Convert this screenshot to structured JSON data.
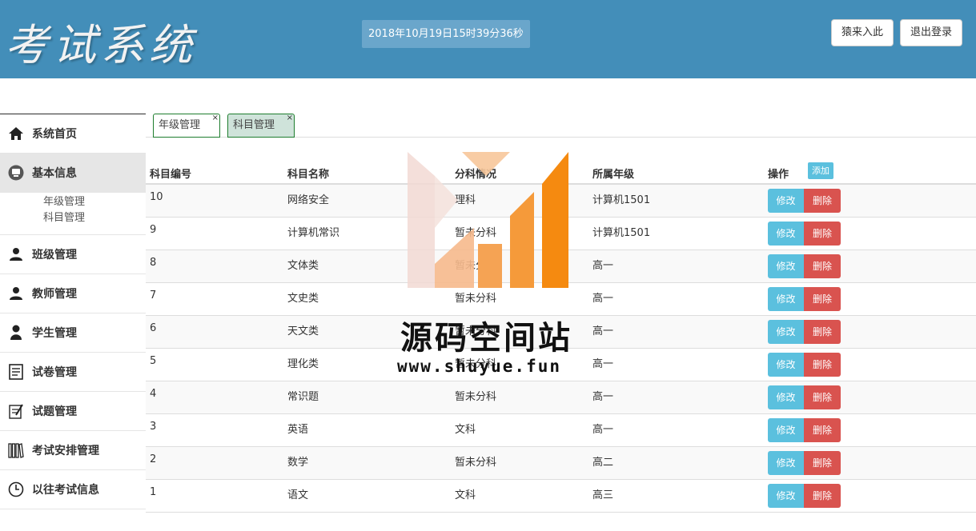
{
  "header": {
    "logo": "考试系统",
    "clock": "2018年10月19日15时39分36秒",
    "guess_label": "猿来入此",
    "logout_label": "退出登录"
  },
  "sidebar": {
    "items": [
      {
        "label": "系统首页",
        "icon": "home-icon"
      },
      {
        "label": "基本信息",
        "icon": "monitor-icon",
        "active": true
      },
      {
        "label": "班级管理",
        "icon": "user-icon"
      },
      {
        "label": "教师管理",
        "icon": "user-icon"
      },
      {
        "label": "学生管理",
        "icon": "user-icon"
      },
      {
        "label": "试卷管理",
        "icon": "document-icon"
      },
      {
        "label": "试题管理",
        "icon": "edit-icon"
      },
      {
        "label": "考试安排管理",
        "icon": "books-icon"
      },
      {
        "label": "以往考试信息",
        "icon": "clock-icon"
      }
    ],
    "subitems": [
      "年级管理",
      "科目管理"
    ]
  },
  "tabs": [
    {
      "label": "年级管理",
      "close": "×"
    },
    {
      "label": "科目管理",
      "close": "×"
    }
  ],
  "table": {
    "headers": [
      "科目编号",
      "科目名称",
      "分科情况",
      "所属年级",
      "操作"
    ],
    "add_label": "添加",
    "edit_label": "修改",
    "delete_label": "删除",
    "rows": [
      [
        "10",
        "网络安全",
        "理科",
        "计算机1501"
      ],
      [
        "9",
        "计算机常识",
        "暂未分科",
        "计算机1501"
      ],
      [
        "8",
        "文体类",
        "暂未分科",
        "高一"
      ],
      [
        "7",
        "文史类",
        "暂未分科",
        "高一"
      ],
      [
        "6",
        "天文类",
        "暂未分科",
        "高一"
      ],
      [
        "5",
        "理化类",
        "暂未分科",
        "高一"
      ],
      [
        "4",
        "常识题",
        "暂未分科",
        "高一"
      ],
      [
        "3",
        "英语",
        "文科",
        "高一"
      ],
      [
        "2",
        "数学",
        "暂未分科",
        "高二"
      ],
      [
        "1",
        "语文",
        "文科",
        "高三"
      ]
    ]
  },
  "watermark": {
    "title": "源码空间站",
    "url": "www.shuyue.fun"
  },
  "colors": {
    "header_bg": "#438eb9",
    "info": "#5bc0de",
    "danger": "#d9534f"
  }
}
